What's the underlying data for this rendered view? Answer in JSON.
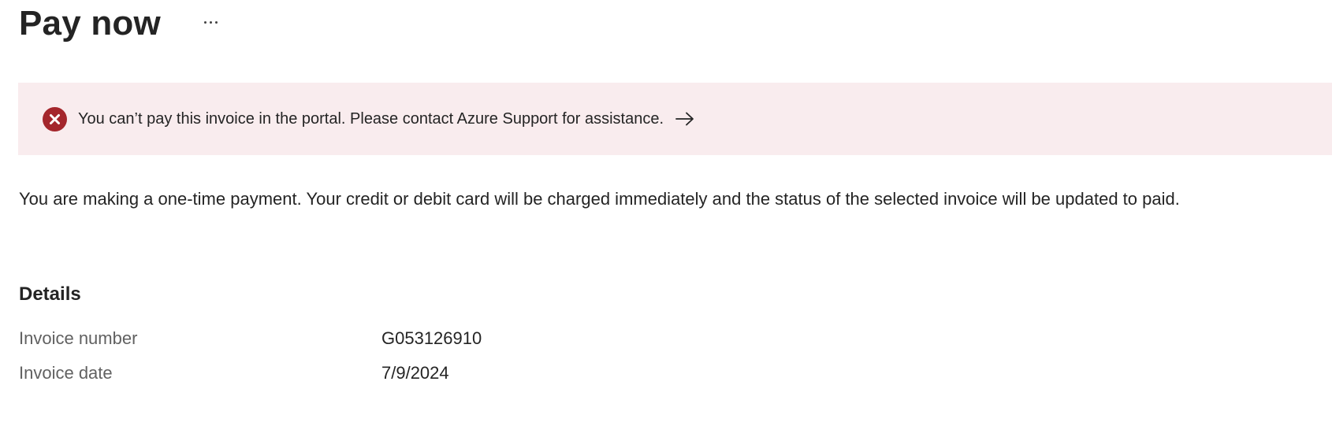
{
  "header": {
    "title": "Pay now",
    "more_icon": "more-horizontal-icon"
  },
  "error_banner": {
    "icon": "error-circle-icon",
    "message": "You can’t pay this invoice in the portal. Please contact Azure Support for assistance.",
    "action_icon": "arrow-right-icon",
    "colors": {
      "background": "#f9ecee",
      "icon": "#a4262c"
    }
  },
  "description": "You are making a one-time payment. Your credit or debit card will be charged immediately and the status of the selected invoice will be updated to paid.",
  "details": {
    "heading": "Details",
    "rows": [
      {
        "label": "Invoice number",
        "value": "G053126910"
      },
      {
        "label": "Invoice date",
        "value": "7/9/2024"
      }
    ]
  }
}
